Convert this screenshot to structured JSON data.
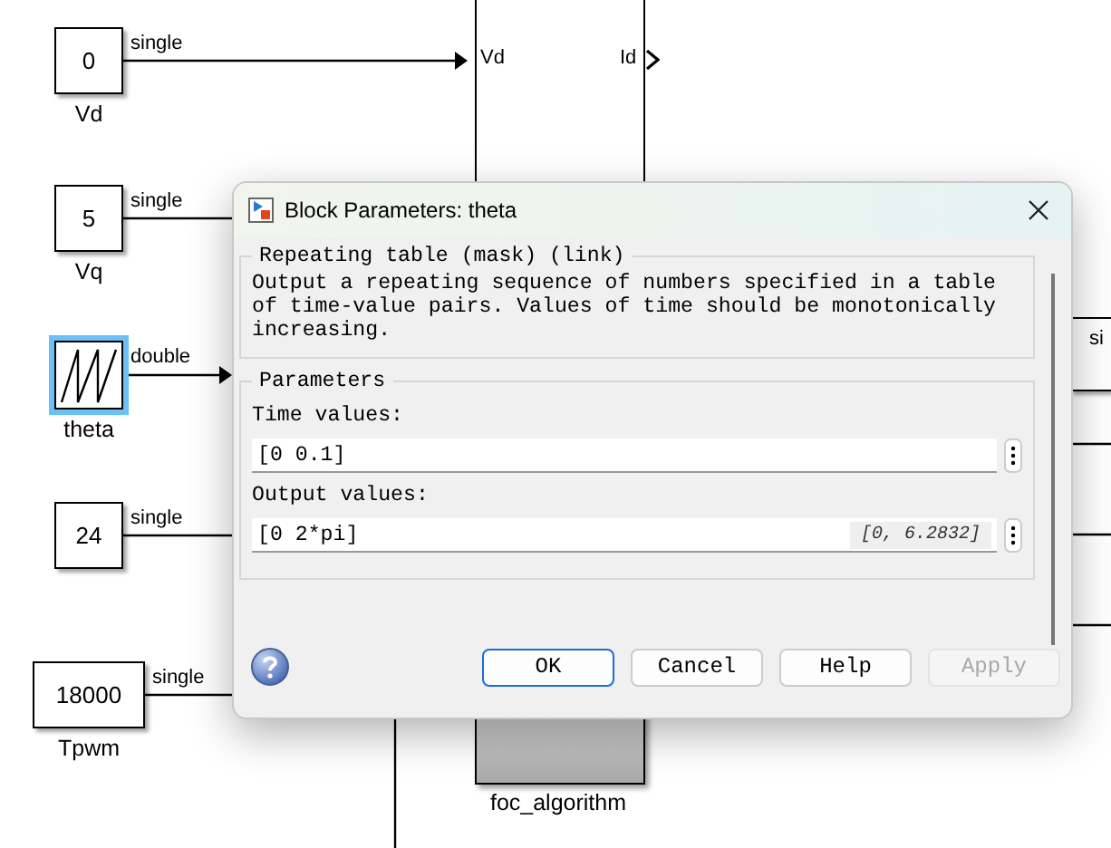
{
  "canvas": {
    "blocks": [
      {
        "kind": "constant",
        "value": "0",
        "name": "Vd",
        "signal": "single",
        "selected": false
      },
      {
        "kind": "constant",
        "value": "5",
        "name": "Vq",
        "signal": "single",
        "selected": false
      },
      {
        "kind": "repeating_table",
        "name": "theta",
        "signal": "double",
        "selected": true
      },
      {
        "kind": "constant",
        "value": "24",
        "signal": "single",
        "selected": false
      },
      {
        "kind": "constant",
        "value": "18000",
        "name": "Tpwm",
        "signal": "single",
        "selected": false
      }
    ],
    "subsystems": [
      {
        "kind": "ports",
        "inport": "Vd",
        "outport": "Id"
      },
      {
        "kind": "named",
        "name": "foc_algorithm"
      }
    ],
    "edge_block": {
      "signal": "si"
    }
  },
  "dialog": {
    "title": "Block Parameters: theta",
    "mask_title": "Repeating table (mask) (link)",
    "description": "Output a repeating sequence of numbers specified in a table of time-value pairs. Values of time should be monotonically increasing.",
    "parameters_title": "Parameters",
    "fields": [
      {
        "label": "Time values:",
        "value": "[0 0.1]"
      },
      {
        "label": "Output values:",
        "value": "[0 2*pi]",
        "evaluated": "[0, 6.2832]"
      }
    ],
    "buttons": [
      {
        "label": "OK",
        "default": true,
        "disabled": false
      },
      {
        "label": "Cancel",
        "default": false,
        "disabled": false
      },
      {
        "label": "Help",
        "default": false,
        "disabled": false
      },
      {
        "label": "Apply",
        "default": false,
        "disabled": true
      }
    ]
  }
}
